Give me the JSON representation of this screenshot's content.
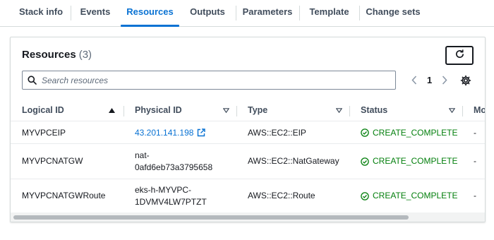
{
  "tabs": [
    {
      "label": "Stack info"
    },
    {
      "label": "Events"
    },
    {
      "label": "Resources",
      "active": true
    },
    {
      "label": "Outputs"
    },
    {
      "label": "Parameters"
    },
    {
      "label": "Template"
    },
    {
      "label": "Change sets"
    }
  ],
  "resources": {
    "title": "Resources",
    "count": "(3)",
    "search_placeholder": "Search resources",
    "page": "1"
  },
  "table": {
    "headers": [
      "Logical ID",
      "Physical ID",
      "Type",
      "Status",
      "Mo"
    ],
    "rows": [
      {
        "logical_id": "MYVPCEIP",
        "physical_id": "43.201.141.198",
        "physical_id_link": true,
        "type": "AWS::EC2::EIP",
        "status": "CREATE_COMPLETE",
        "extra": "-"
      },
      {
        "logical_id": "MYVPCNATGW",
        "physical_id": "nat-\n0afd6eb73a3795658",
        "physical_id_link": false,
        "type": "AWS::EC2::NatGateway",
        "status": "CREATE_COMPLETE",
        "extra": "-"
      },
      {
        "logical_id": "MYVPCNATGWRoute",
        "physical_id": "eks-h-MYVPC-\n1DVMV4LW7PTZT",
        "physical_id_link": false,
        "type": "AWS::EC2::Route",
        "status": "CREATE_COMPLETE",
        "extra": "-"
      }
    ]
  },
  "colors": {
    "accent": "#0972d3",
    "success": "#037f0c",
    "text": "#16191f",
    "border": "#d5dbdb"
  },
  "icons": [
    "refresh-icon",
    "search-icon",
    "chevron-left-icon",
    "chevron-right-icon",
    "settings-gear-icon",
    "sort-up-icon",
    "sort-down-icon",
    "external-link-icon",
    "check-circle-icon"
  ]
}
